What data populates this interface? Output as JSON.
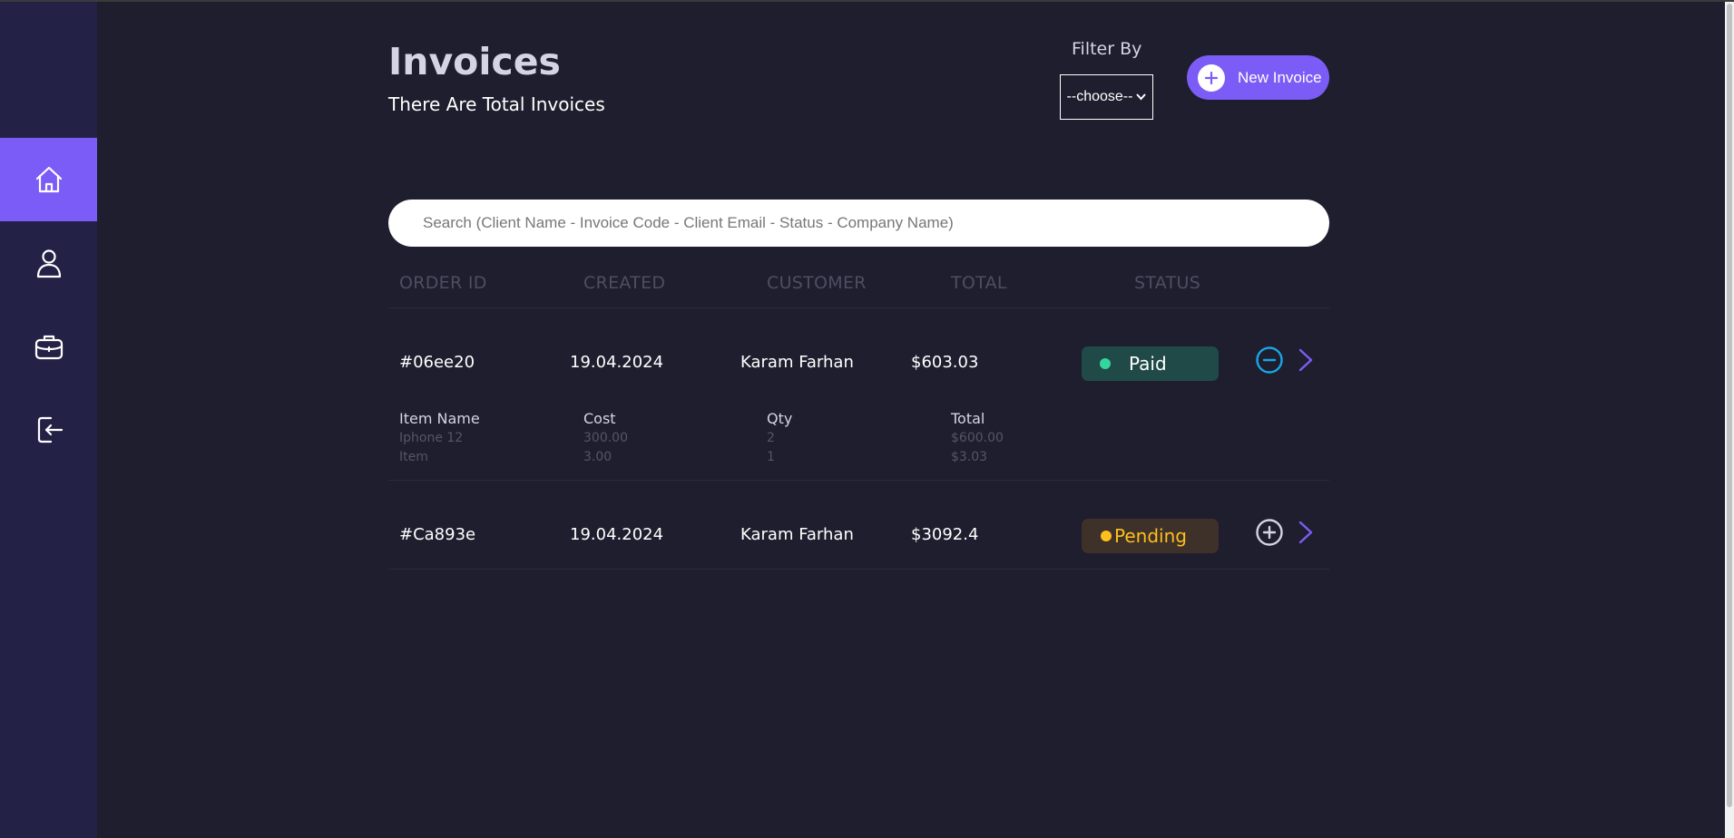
{
  "header": {
    "title": "Invoices",
    "subtitle": "There Are Total Invoices"
  },
  "filter": {
    "label": "Filter By",
    "selected": "--choose--"
  },
  "new_invoice": {
    "label": "New Invoice"
  },
  "search": {
    "placeholder": "Search (Client Name - Invoice Code - Client Email - Status - Company Name)"
  },
  "table": {
    "headers": {
      "order_id": "ORDER ID",
      "created": "CREATED",
      "customer": "CUSTOMER",
      "total": "TOTAL",
      "status": "STATUS"
    },
    "rows": [
      {
        "order_id": "#06ee20",
        "created": "19.04.2024",
        "customer": "Karam Farhan",
        "total": "$603.03",
        "status": "Paid",
        "expanded": true,
        "details": {
          "headers": {
            "name": "Item Name",
            "cost": "Cost",
            "qty": "Qty",
            "total": "Total"
          },
          "items": [
            {
              "name": "Iphone 12",
              "cost": "300.00",
              "qty": "2",
              "total": "$600.00"
            },
            {
              "name": "Item",
              "cost": "3.00",
              "qty": "1",
              "total": "$3.03"
            }
          ]
        }
      },
      {
        "order_id": "#Ca893e",
        "created": "19.04.2024",
        "customer": "Karam Farhan",
        "total": "$3092.4",
        "status": "Pending",
        "expanded": false
      }
    ]
  },
  "sidebar": {
    "items": [
      {
        "icon": "home-icon",
        "active": true
      },
      {
        "icon": "user-icon",
        "active": false
      },
      {
        "icon": "briefcase-icon",
        "active": false
      },
      {
        "icon": "logout-icon",
        "active": false
      }
    ]
  },
  "colors": {
    "accent": "#7c5cf6",
    "background": "#1f1e2e",
    "sidebar": "#232246",
    "paid_bg": "#1f4a47",
    "paid_dot": "#33d69f",
    "pending_bg": "#3d3129",
    "pending_text": "#ffbf1f",
    "collapse_icon": "#18a6e8"
  }
}
